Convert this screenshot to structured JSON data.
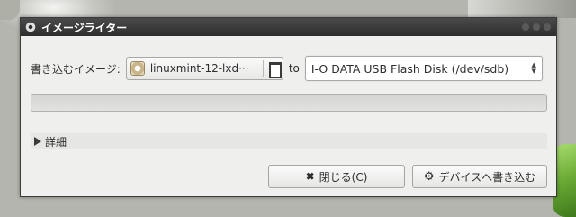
{
  "window": {
    "title": "イメージライター"
  },
  "form": {
    "image_label": "書き込むイメージ:",
    "image_file": "linuxmint-12-lxd···",
    "to_label": "to",
    "target_device": "I-O DATA USB Flash Disk (/dev/sdb)"
  },
  "progress": {
    "fraction": 0
  },
  "details": {
    "label": "詳細"
  },
  "buttons": {
    "close_label": "閉じる(C)",
    "write_label": "デバイスへ書き込む"
  },
  "icons": {
    "close": "times-icon",
    "write": "gear-icon",
    "file": "disc-image-icon",
    "browse": "document-icon"
  }
}
